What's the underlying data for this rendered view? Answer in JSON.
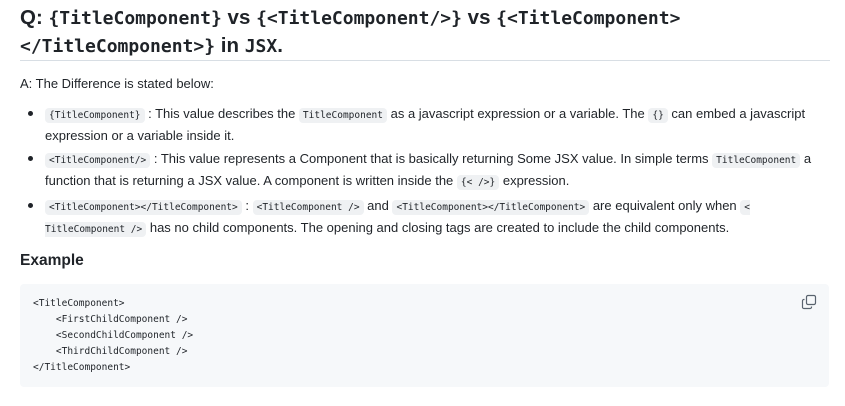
{
  "question": {
    "prefix": "Q: ",
    "code1": "{TitleComponent}",
    "sep1": " vs ",
    "code2": "{<TitleComponent/>}",
    "sep2": " vs ",
    "code3a": "{<TitleComponent>",
    "code3b": "</TitleComponent>}",
    "sep3": " in ",
    "code4": "JSX",
    "suffix": "."
  },
  "answer_intro": "A: The Difference is stated below:",
  "items": [
    {
      "code": "{TitleComponent}",
      "text1": " : This value describes the ",
      "code2": "TitleComponent",
      "text2": " as a javascript expression or a variable. The ",
      "code3": "{}",
      "text3": " can embed a javascript expression or a variable inside it."
    },
    {
      "code": "<TitleComponent/>",
      "text1": " : This value represents a Component that is basically returning Some JSX value. In simple terms ",
      "code2": "TitleComponent",
      "text2": " a function that is returning a JSX value. A component is written inside the ",
      "code3": "{< />}",
      "text3": " expression."
    },
    {
      "code": "<TitleComponent></TitleComponent>",
      "text1": " : ",
      "code2": "<TitleComponent />",
      "text2": " and ",
      "code3": "<TitleComponent></TitleComponent>",
      "text3": " are equivalent only when ",
      "code4": "< TitleComponent />",
      "text4": " has no child components. The opening and closing tags are created to include the child components."
    }
  ],
  "example_heading": "Example",
  "code_example": "<TitleComponent>\n    <FirstChildComponent />\n    <SecondChildComponent />\n    <ThirdChildComponent />\n</TitleComponent>",
  "icons": {
    "copy": "copy-icon"
  },
  "colors": {
    "text": "#1f2328",
    "code_bg": "#f6f8fa",
    "inline_code_bg": "#eff1f3",
    "rule": "#d8dee4"
  }
}
